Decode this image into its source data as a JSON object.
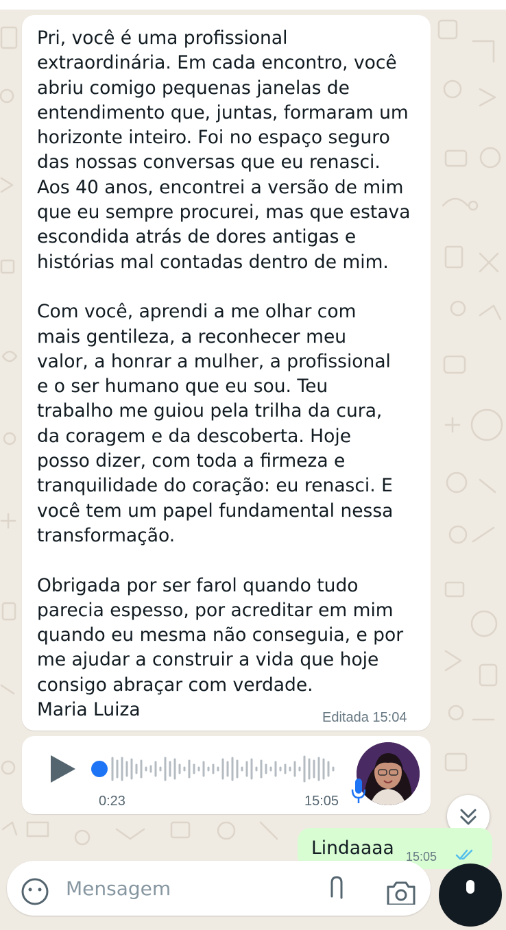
{
  "conversation": {
    "incoming_message": {
      "text": "Pri, você é uma profissional\nextraordinária. Em cada encontro, você\nabriu comigo pequenas janelas de\nentendimento que, juntas, formaram um\nhorizonte inteiro. Foi no espaço seguro\ndas nossas conversas que eu renasci.\nAos 40 anos, encontrei a versão de mim\nque eu sempre procurei, mas que estava\nescondida atrás de dores antigas e\nhistórias mal contadas dentro de mim.\n\nCom você, aprendi a me olhar com\nmais gentileza, a reconhecer meu\nvalor, a honrar a mulher, a profissional\ne o ser humano que eu sou. Teu\ntrabalho me guiou pela trilha da cura,\nda coragem e da descoberta. Hoje\nposso dizer, com toda a firmeza e\ntranquilidade do coração: eu renasci. E\nvocê tem um papel fundamental nessa\ntransformação.\n\nObrigada por ser farol quando tudo\nparecia espesso, por acreditar em mim\nquando eu mesma não conseguia, e por\nme ajudar a construir a vida que hoje\nconsigo abraçar com verdade.\nMaria Luiza",
      "meta": "Editada 15:04"
    },
    "voice_message": {
      "duration": "0:23",
      "time": "15:05",
      "icons": [
        "play-icon",
        "microphone-icon",
        "avatar"
      ]
    },
    "outgoing_message": {
      "text": "Lindaaaa",
      "time": "15:05",
      "status_icon": "double-check-icon"
    }
  },
  "composer": {
    "placeholder": "Mensagem",
    "icons": [
      "emoji-icon",
      "attach-icon",
      "camera-icon",
      "microphone-icon"
    ]
  },
  "colors": {
    "chat_background": "#efeae2",
    "incoming_bubble": "#ffffff",
    "outgoing_bubble": "#d9fdd3",
    "read_ticks": "#53bdeb",
    "voice_progress": "#1d74f5"
  }
}
